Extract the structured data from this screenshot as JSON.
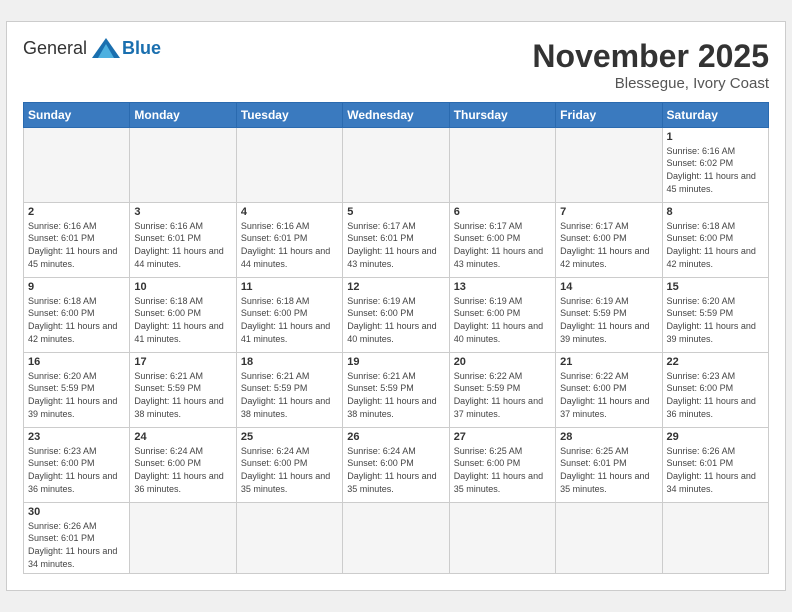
{
  "logo": {
    "general": "General",
    "blue": "Blue"
  },
  "title": "November 2025",
  "subtitle": "Blessegue, Ivory Coast",
  "days_of_week": [
    "Sunday",
    "Monday",
    "Tuesday",
    "Wednesday",
    "Thursday",
    "Friday",
    "Saturday"
  ],
  "weeks": [
    [
      {
        "day": "",
        "info": ""
      },
      {
        "day": "",
        "info": ""
      },
      {
        "day": "",
        "info": ""
      },
      {
        "day": "",
        "info": ""
      },
      {
        "day": "",
        "info": ""
      },
      {
        "day": "",
        "info": ""
      },
      {
        "day": "1",
        "info": "Sunrise: 6:16 AM\nSunset: 6:02 PM\nDaylight: 11 hours and 45 minutes."
      }
    ],
    [
      {
        "day": "2",
        "info": "Sunrise: 6:16 AM\nSunset: 6:01 PM\nDaylight: 11 hours and 45 minutes."
      },
      {
        "day": "3",
        "info": "Sunrise: 6:16 AM\nSunset: 6:01 PM\nDaylight: 11 hours and 44 minutes."
      },
      {
        "day": "4",
        "info": "Sunrise: 6:16 AM\nSunset: 6:01 PM\nDaylight: 11 hours and 44 minutes."
      },
      {
        "day": "5",
        "info": "Sunrise: 6:17 AM\nSunset: 6:01 PM\nDaylight: 11 hours and 43 minutes."
      },
      {
        "day": "6",
        "info": "Sunrise: 6:17 AM\nSunset: 6:00 PM\nDaylight: 11 hours and 43 minutes."
      },
      {
        "day": "7",
        "info": "Sunrise: 6:17 AM\nSunset: 6:00 PM\nDaylight: 11 hours and 42 minutes."
      },
      {
        "day": "8",
        "info": "Sunrise: 6:18 AM\nSunset: 6:00 PM\nDaylight: 11 hours and 42 minutes."
      }
    ],
    [
      {
        "day": "9",
        "info": "Sunrise: 6:18 AM\nSunset: 6:00 PM\nDaylight: 11 hours and 42 minutes."
      },
      {
        "day": "10",
        "info": "Sunrise: 6:18 AM\nSunset: 6:00 PM\nDaylight: 11 hours and 41 minutes."
      },
      {
        "day": "11",
        "info": "Sunrise: 6:18 AM\nSunset: 6:00 PM\nDaylight: 11 hours and 41 minutes."
      },
      {
        "day": "12",
        "info": "Sunrise: 6:19 AM\nSunset: 6:00 PM\nDaylight: 11 hours and 40 minutes."
      },
      {
        "day": "13",
        "info": "Sunrise: 6:19 AM\nSunset: 6:00 PM\nDaylight: 11 hours and 40 minutes."
      },
      {
        "day": "14",
        "info": "Sunrise: 6:19 AM\nSunset: 5:59 PM\nDaylight: 11 hours and 39 minutes."
      },
      {
        "day": "15",
        "info": "Sunrise: 6:20 AM\nSunset: 5:59 PM\nDaylight: 11 hours and 39 minutes."
      }
    ],
    [
      {
        "day": "16",
        "info": "Sunrise: 6:20 AM\nSunset: 5:59 PM\nDaylight: 11 hours and 39 minutes."
      },
      {
        "day": "17",
        "info": "Sunrise: 6:21 AM\nSunset: 5:59 PM\nDaylight: 11 hours and 38 minutes."
      },
      {
        "day": "18",
        "info": "Sunrise: 6:21 AM\nSunset: 5:59 PM\nDaylight: 11 hours and 38 minutes."
      },
      {
        "day": "19",
        "info": "Sunrise: 6:21 AM\nSunset: 5:59 PM\nDaylight: 11 hours and 38 minutes."
      },
      {
        "day": "20",
        "info": "Sunrise: 6:22 AM\nSunset: 5:59 PM\nDaylight: 11 hours and 37 minutes."
      },
      {
        "day": "21",
        "info": "Sunrise: 6:22 AM\nSunset: 6:00 PM\nDaylight: 11 hours and 37 minutes."
      },
      {
        "day": "22",
        "info": "Sunrise: 6:23 AM\nSunset: 6:00 PM\nDaylight: 11 hours and 36 minutes."
      }
    ],
    [
      {
        "day": "23",
        "info": "Sunrise: 6:23 AM\nSunset: 6:00 PM\nDaylight: 11 hours and 36 minutes."
      },
      {
        "day": "24",
        "info": "Sunrise: 6:24 AM\nSunset: 6:00 PM\nDaylight: 11 hours and 36 minutes."
      },
      {
        "day": "25",
        "info": "Sunrise: 6:24 AM\nSunset: 6:00 PM\nDaylight: 11 hours and 35 minutes."
      },
      {
        "day": "26",
        "info": "Sunrise: 6:24 AM\nSunset: 6:00 PM\nDaylight: 11 hours and 35 minutes."
      },
      {
        "day": "27",
        "info": "Sunrise: 6:25 AM\nSunset: 6:00 PM\nDaylight: 11 hours and 35 minutes."
      },
      {
        "day": "28",
        "info": "Sunrise: 6:25 AM\nSunset: 6:01 PM\nDaylight: 11 hours and 35 minutes."
      },
      {
        "day": "29",
        "info": "Sunrise: 6:26 AM\nSunset: 6:01 PM\nDaylight: 11 hours and 34 minutes."
      }
    ],
    [
      {
        "day": "30",
        "info": "Sunrise: 6:26 AM\nSunset: 6:01 PM\nDaylight: 11 hours and 34 minutes."
      },
      {
        "day": "",
        "info": ""
      },
      {
        "day": "",
        "info": ""
      },
      {
        "day": "",
        "info": ""
      },
      {
        "day": "",
        "info": ""
      },
      {
        "day": "",
        "info": ""
      },
      {
        "day": "",
        "info": ""
      }
    ]
  ]
}
